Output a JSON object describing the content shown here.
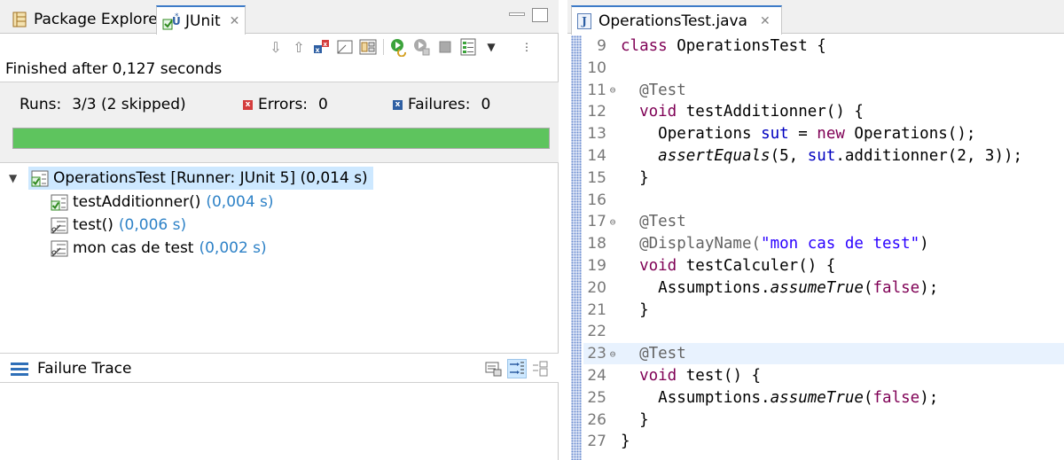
{
  "left": {
    "tabs": [
      {
        "label": "Package Explorer",
        "icon": "package-explorer-icon"
      },
      {
        "label": "JUnit",
        "icon": "junit-icon",
        "active": true
      }
    ],
    "status": "Finished after 0,127 seconds",
    "stats": {
      "runs_label": "Runs:",
      "runs_value": "3/3 (2 skipped)",
      "errors_label": "Errors:",
      "errors_value": "0",
      "failures_label": "Failures:",
      "failures_value": "0"
    },
    "progress": {
      "fraction": 1.0,
      "color": "#5ec45e"
    },
    "tree": {
      "root": {
        "name": "OperationsTest [Runner: JUnit 5] (0,014 s)"
      },
      "children": [
        {
          "name": "testAdditionner()",
          "time": "(0,004 s)",
          "status": "passed"
        },
        {
          "name": "test()",
          "time": "(0,006 s)",
          "status": "skipped"
        },
        {
          "name": "mon cas de test",
          "time": "(0,002 s)",
          "status": "skipped"
        }
      ]
    },
    "failure_trace": {
      "title": "Failure Trace"
    }
  },
  "editor": {
    "tab_label": "OperationsTest.java",
    "lines": [
      {
        "n": "9",
        "fold": ""
      },
      {
        "n": "10",
        "fold": ""
      },
      {
        "n": "11",
        "fold": "⊖"
      },
      {
        "n": "12",
        "fold": ""
      },
      {
        "n": "13",
        "fold": ""
      },
      {
        "n": "14",
        "fold": ""
      },
      {
        "n": "15",
        "fold": ""
      },
      {
        "n": "16",
        "fold": ""
      },
      {
        "n": "17",
        "fold": "⊖"
      },
      {
        "n": "18",
        "fold": ""
      },
      {
        "n": "19",
        "fold": ""
      },
      {
        "n": "20",
        "fold": ""
      },
      {
        "n": "21",
        "fold": ""
      },
      {
        "n": "22",
        "fold": ""
      },
      {
        "n": "23",
        "fold": "⊖"
      },
      {
        "n": "24",
        "fold": ""
      },
      {
        "n": "25",
        "fold": ""
      },
      {
        "n": "26",
        "fold": ""
      },
      {
        "n": "27",
        "fold": ""
      }
    ],
    "code": {
      "l9_kw": "class",
      "l9_rest": " OperationsTest {",
      "l11": "@Test",
      "l12_kw": "void",
      "l12_rest": " testAdditionner() {",
      "l13_a": "Operations ",
      "l13_fld": "sut",
      "l13_b": " = ",
      "l13_kw": "new",
      "l13_c": " Operations();",
      "l14_ital": "assertEquals",
      "l14_a": "(5, ",
      "l14_fld": "sut",
      "l14_b": ".additionner(2, 3));",
      "l15": "}",
      "l17": "@Test",
      "l18_ann": "@DisplayName(",
      "l18_str": "\"mon cas de test\"",
      "l18_b": ")",
      "l19_kw": "void",
      "l19_rest": " testCalculer() {",
      "l20_a": "Assumptions.",
      "l20_ital": "assumeTrue",
      "l20_b": "(",
      "l20_kw": "false",
      "l20_c": ");",
      "l21": "}",
      "l23": "@Test",
      "l24_kw": "void",
      "l24_rest": " test() {",
      "l25_a": "Assumptions.",
      "l25_ital": "assumeTrue",
      "l25_b": "(",
      "l25_kw": "false",
      "l25_c": ");",
      "l26": "}",
      "l27": "}"
    },
    "highlight_line": "23",
    "colors": {
      "keyword": "#7f0055",
      "annotation": "#646464",
      "string": "#2a00ff",
      "field": "#0000c0",
      "highlight": "#e8f2fe"
    }
  }
}
